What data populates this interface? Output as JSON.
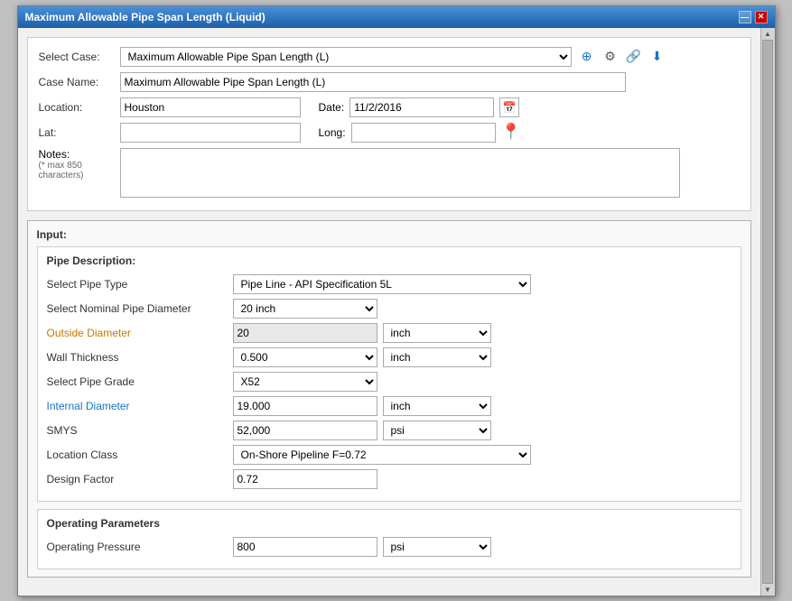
{
  "window": {
    "title": "Maximum Allowable Pipe Span Length (Liquid)"
  },
  "header": {
    "select_case_label": "Select Case:",
    "select_case_value": "Maximum Allowable Pipe Span Length (L)",
    "case_name_label": "Case Name:",
    "case_name_value": "Maximum Allowable Pipe Span Length (L)",
    "location_label": "Location:",
    "location_value": "Houston",
    "date_label": "Date:",
    "date_value": "11/2/2016",
    "lat_label": "Lat:",
    "long_label": "Long:",
    "notes_label": "Notes:",
    "notes_sublabel": "(* max 850 characters)",
    "notes_value": ""
  },
  "input_section": {
    "title": "Input:",
    "pipe_description": {
      "title": "Pipe Description:",
      "pipe_type_label": "Select Pipe Type",
      "pipe_type_value": "Pipe Line - API Specification 5L",
      "nominal_diameter_label": "Select Nominal Pipe Diameter",
      "nominal_diameter_value": "20 inch",
      "outside_diameter_label": "Outside Diameter",
      "outside_diameter_value": "20",
      "outside_diameter_unit": "inch",
      "wall_thickness_label": "Wall Thickness",
      "wall_thickness_value": "0.500",
      "wall_thickness_unit": "inch",
      "pipe_grade_label": "Select Pipe Grade",
      "pipe_grade_value": "X52",
      "internal_diameter_label": "Internal Diameter",
      "internal_diameter_value": "19.000",
      "internal_diameter_unit": "inch",
      "smys_label": "SMYS",
      "smys_value": "52,000",
      "smys_unit": "psi",
      "location_class_label": "Location Class",
      "location_class_value": "On-Shore Pipeline F=0.72",
      "design_factor_label": "Design Factor",
      "design_factor_value": "0.72"
    },
    "operating_parameters": {
      "title": "Operating Parameters",
      "op_pressure_label": "Operating Pressure",
      "op_pressure_value": "800",
      "op_pressure_unit": "psi"
    }
  },
  "icons": {
    "add": "⊕",
    "settings": "⚙",
    "share": "🔗",
    "download": "⬇",
    "calendar": "📅",
    "location_pin": "📍"
  }
}
